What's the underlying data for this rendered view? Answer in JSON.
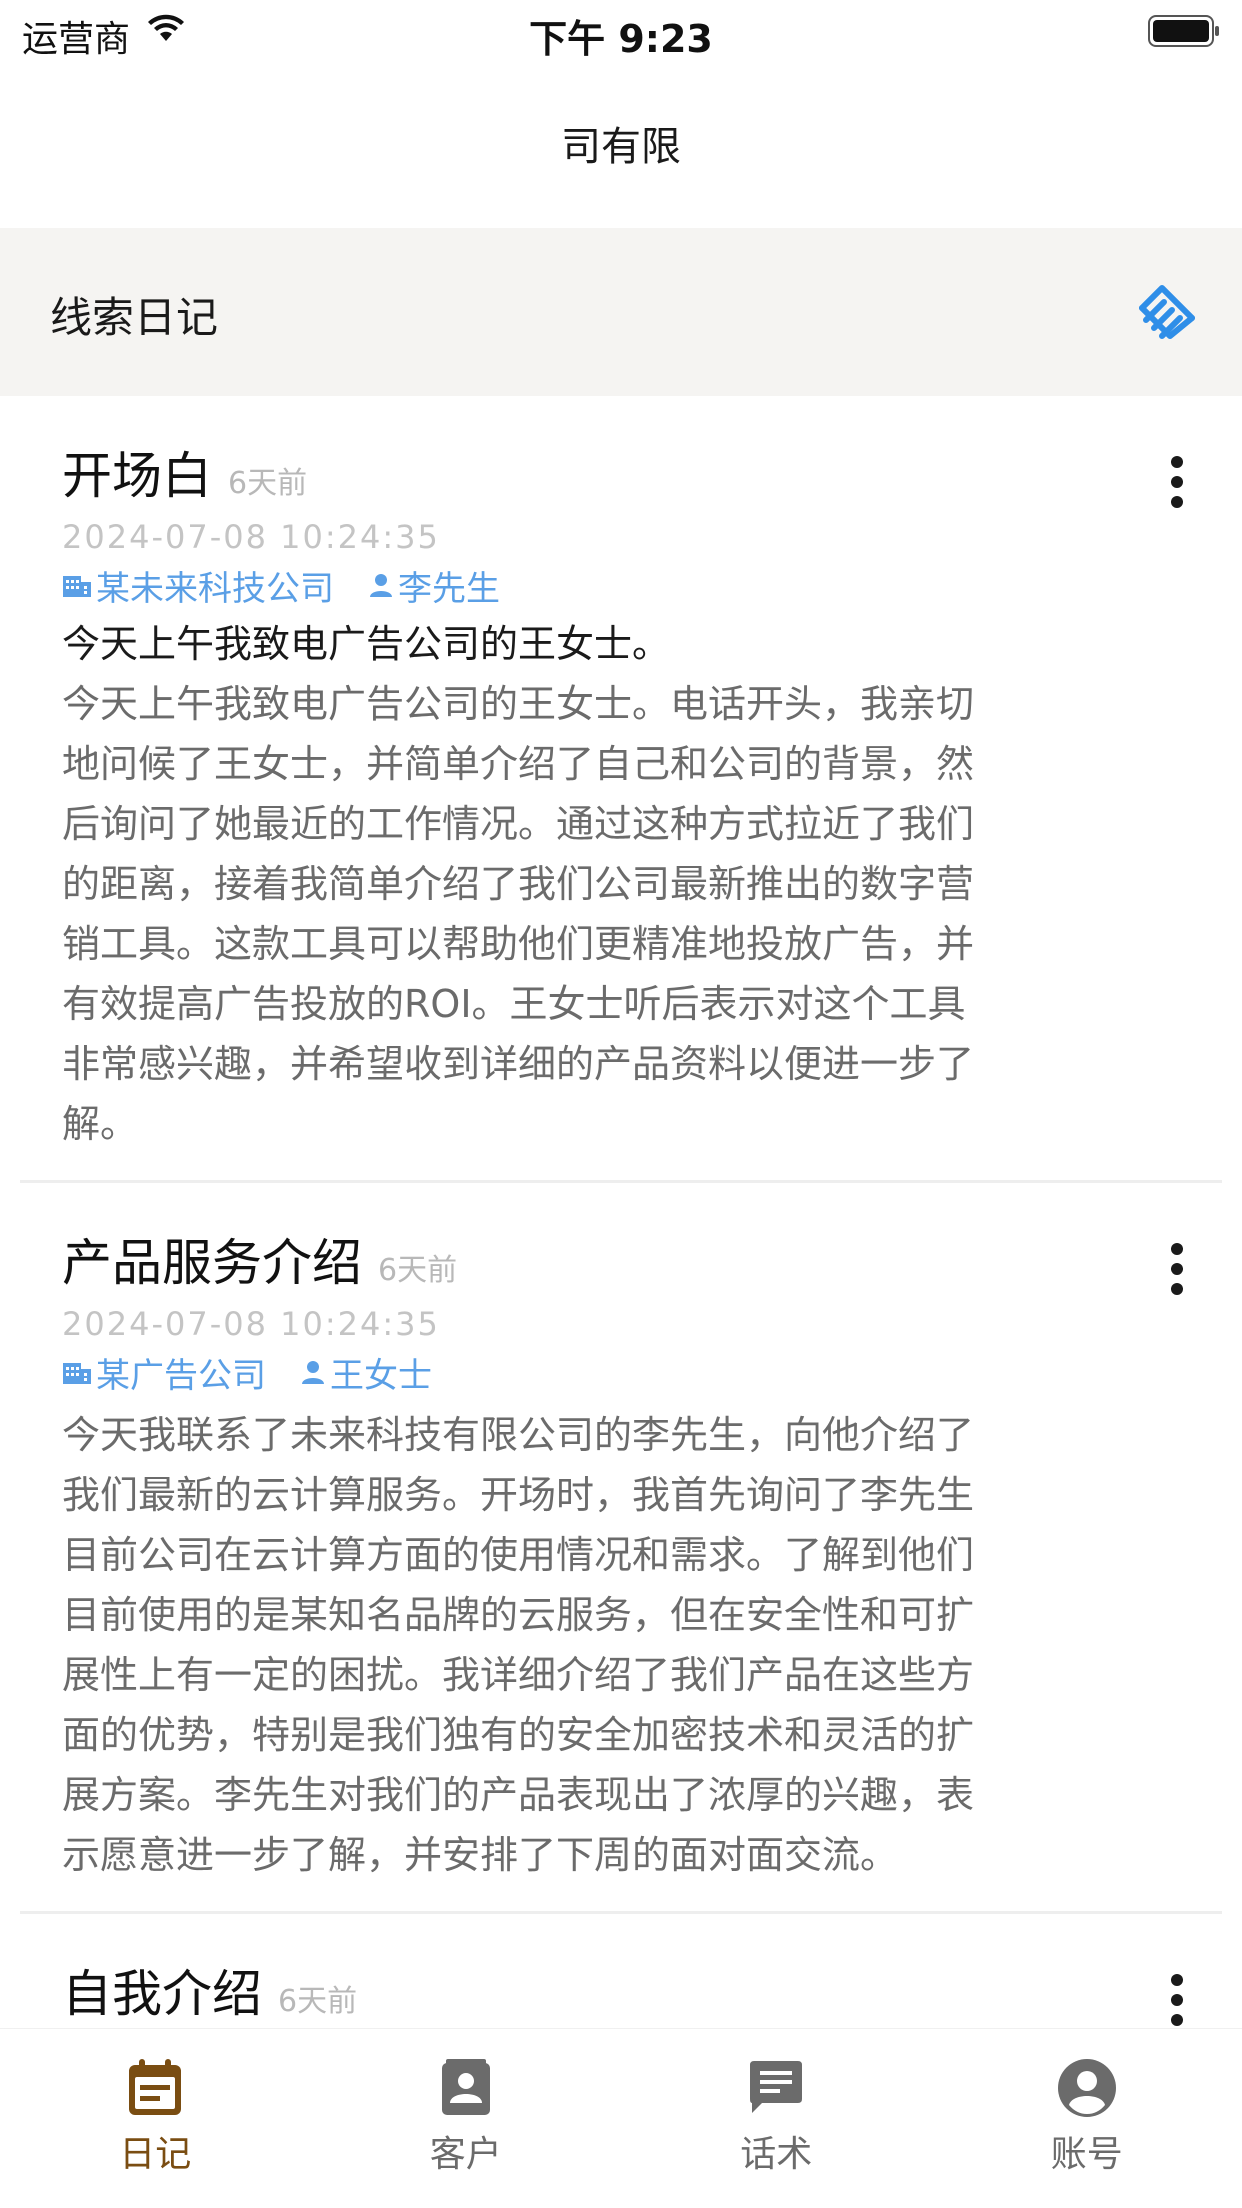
{
  "status_bar": {
    "carrier": "运营商",
    "time": "下午 9:23"
  },
  "nav": {
    "title": "司有限"
  },
  "section": {
    "title": "线索日记"
  },
  "entries": [
    {
      "title": "开场白",
      "ago": "6天前",
      "date": "2024-07-08 10:24:35",
      "company": "某未来科技公司",
      "contact": "李先生",
      "summary": "今天上午我致电广告公司的王女士。",
      "body": "今天上午我致电广告公司的王女士。电话开头，我亲切地问候了王女士，并简单介绍了自己和公司的背景，然后询问了她最近的工作情况。通过这种方式拉近了我们的距离，接着我简单介绍了我们公司最新推出的数字营销工具。这款工具可以帮助他们更精准地投放广告，并有效提高广告投放的ROI。王女士听后表示对这个工具非常感兴趣，并希望收到详细的产品资料以便进一步了解。"
    },
    {
      "title": "产品服务介绍",
      "ago": "6天前",
      "date": "2024-07-08 10:24:35",
      "company": "某广告公司",
      "contact": "王女士",
      "summary": "",
      "body": "今天我联系了未来科技有限公司的李先生，向他介绍了我们最新的云计算服务。开场时，我首先询问了李先生目前公司在云计算方面的使用情况和需求。了解到他们目前使用的是某知名品牌的云服务，但在安全性和可扩展性上有一定的困扰。我详细介绍了我们产品在这些方面的优势，特别是我们独有的安全加密技术和灵活的扩展方案。李先生对我们的产品表现出了浓厚的兴趣，表示愿意进一步了解，并安排了下周的面对面交流。"
    },
    {
      "title": "自我介绍",
      "ago": "6天前",
      "date": "",
      "company": "",
      "contact": "",
      "summary": "",
      "body": ""
    }
  ],
  "tabs": [
    {
      "label": "日记",
      "icon": "calendar-icon",
      "active": true
    },
    {
      "label": "客户",
      "icon": "contacts-icon",
      "active": false
    },
    {
      "label": "话术",
      "icon": "chat-icon",
      "active": false
    },
    {
      "label": "账号",
      "icon": "account-icon",
      "active": false
    }
  ],
  "colors": {
    "accent": "#7a4d12",
    "link": "#5a9fe6",
    "icon_blue": "#2f8ee8"
  }
}
